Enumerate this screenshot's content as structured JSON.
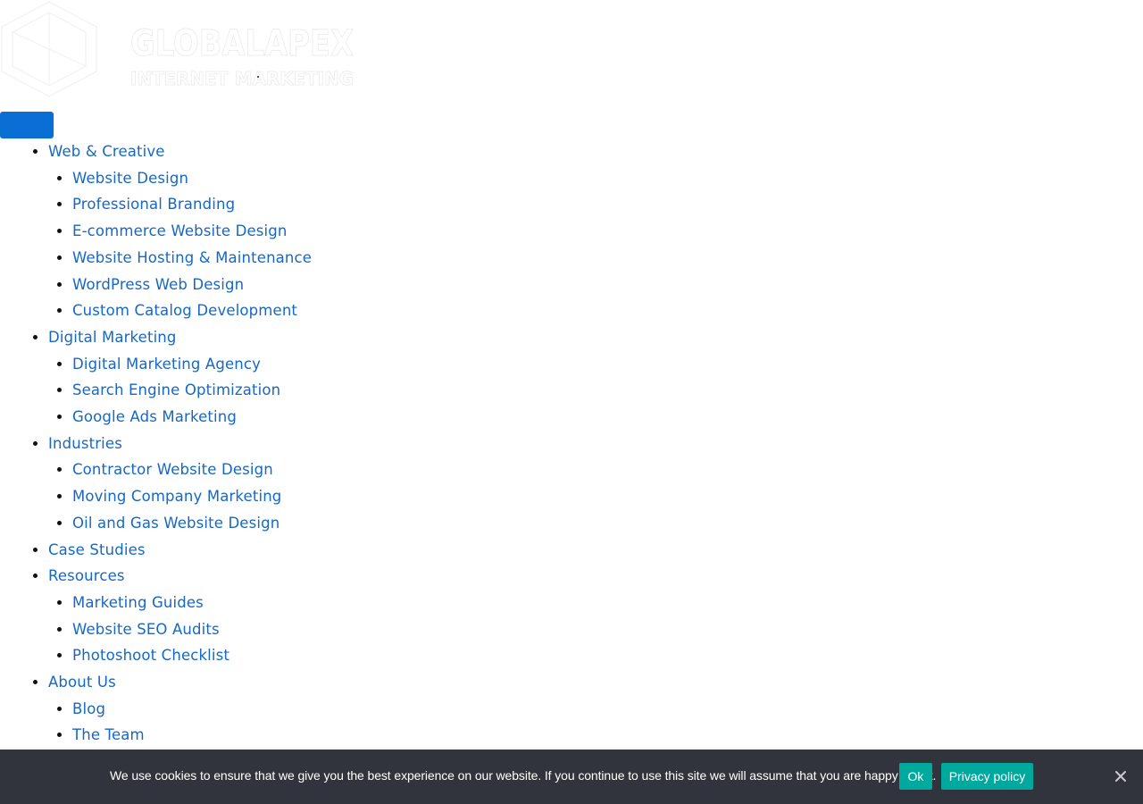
{
  "logo": {
    "icon": "hexagon-logo-icon",
    "line1": "GLOBALAPEX",
    "line2": "INTERNET MARKETING"
  },
  "menu_toggle": {
    "icon": "menu-toggle-button"
  },
  "nav": {
    "items": [
      {
        "label": "Web & Creative",
        "children": [
          {
            "label": "Website Design"
          },
          {
            "label": "Professional Branding"
          },
          {
            "label": "E-commerce Website Design"
          },
          {
            "label": "Website Hosting & Maintenance"
          },
          {
            "label": "WordPress Web Design"
          },
          {
            "label": "Custom Catalog Development"
          }
        ]
      },
      {
        "label": "Digital Marketing",
        "children": [
          {
            "label": "Digital Marketing Agency"
          },
          {
            "label": "Search Engine Optimization"
          },
          {
            "label": "Google Ads Marketing"
          }
        ]
      },
      {
        "label": "Industries",
        "children": [
          {
            "label": "Contractor Website Design"
          },
          {
            "label": "Moving Company Marketing"
          },
          {
            "label": "Oil and Gas Website Design"
          }
        ]
      },
      {
        "label": "Case Studies",
        "children": []
      },
      {
        "label": "Resources",
        "children": [
          {
            "label": "Marketing Guides"
          },
          {
            "label": "Website SEO Audits"
          },
          {
            "label": "Photoshoot Checklist"
          }
        ]
      },
      {
        "label": "About Us",
        "children": [
          {
            "label": "Blog"
          },
          {
            "label": "The Team"
          }
        ]
      }
    ]
  },
  "cookie": {
    "message": "We use cookies to ensure that we give you the best experience on our website. If you continue to use this site we will assume that you are happy with it.",
    "ok_label": "Ok",
    "privacy_label": "Privacy policy",
    "close_icon": "close-icon"
  },
  "colors": {
    "link": "#1668c4",
    "toggle": "#0a6fd4",
    "cookie_bg": "#32343d",
    "cookie_button": "#00a99d"
  }
}
